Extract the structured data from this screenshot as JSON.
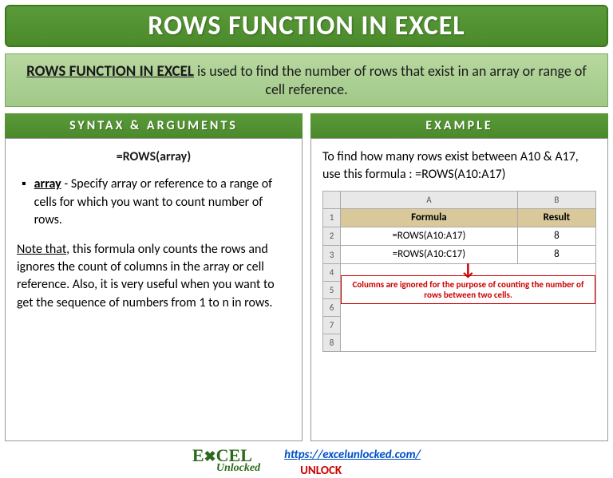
{
  "title": "ROWS FUNCTION IN EXCEL",
  "intro_bold": "ROWS FUNCTION IN EXCEL",
  "intro_rest": " is used to find the number of rows that exist in an array or range of cell reference.",
  "syntax": {
    "heading": "SYNTAX & ARGUMENTS",
    "formula": "=ROWS(array)",
    "arg_name": "array",
    "arg_desc": " - Specify array or reference to a range of cells for which you want to count number of rows.",
    "note_label": "Note that",
    "note_text": ", this formula only counts the rows and ignores the count of columns in the array or cell reference. Also, it is very useful when you want to get the sequence of numbers from 1 to n in rows."
  },
  "example": {
    "heading": "EXAMPLE",
    "intro": "To find how many rows exist between A10 & A17, use this formula : =ROWS(A10:A17)",
    "colA": "A",
    "colB": "B",
    "hdr_formula": "Formula",
    "hdr_result": "Result",
    "rows": [
      {
        "n": "1",
        "f": "",
        "r": ""
      },
      {
        "n": "2",
        "f": "=ROWS(A10:A17)",
        "r": "8"
      },
      {
        "n": "3",
        "f": "=ROWS(A10:C17)",
        "r": "8"
      }
    ],
    "r4": "4",
    "r5": "5",
    "r6": "6",
    "r7": "7",
    "r8": "8",
    "callout": "Columns are ignored for the purpose of counting the number of rows between two cells."
  },
  "footer": {
    "logo1": "E",
    "logo2": "CEL",
    "logo_sub": "Unlocked",
    "url": "https://excelunlocked.com/",
    "unlock": "UNLOCK"
  }
}
